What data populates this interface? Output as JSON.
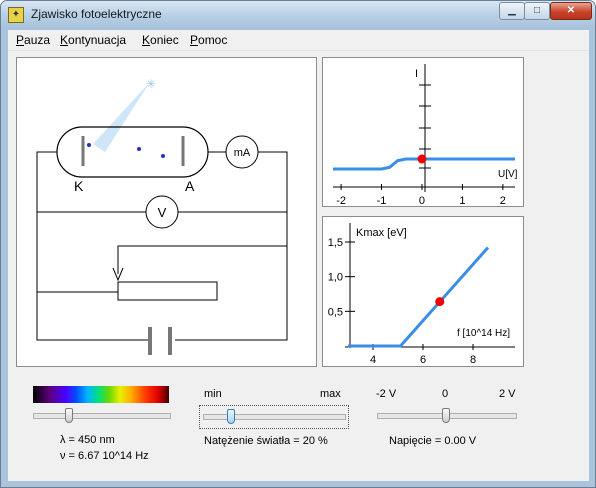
{
  "window": {
    "title": "Zjawisko fotoelektryczne"
  },
  "menu": [
    {
      "label": "Pauza"
    },
    {
      "label": "Kontynuacja"
    },
    {
      "label": "Koniec"
    },
    {
      "label": "Pomoc"
    }
  ],
  "circuit": {
    "cathode_label": "K",
    "anode_label": "A",
    "ammeter_label": "mA",
    "voltmeter_label": "V"
  },
  "iv_graph": {
    "ylabel": "I",
    "xlabel": "U[V]",
    "x_ticks": [
      "-2",
      "-1",
      "0",
      "1",
      "2"
    ]
  },
  "k_graph": {
    "ylabel": "Kmax [eV]",
    "xlabel": "f [10^14 Hz]",
    "x_ticks": [
      "4",
      "6",
      "8"
    ],
    "y_ticks": [
      "1,5",
      "1,0",
      "0,5"
    ]
  },
  "chart_data": [
    {
      "type": "line",
      "title": "",
      "xlabel": "U[V]",
      "ylabel": "I",
      "xlim": [
        -2.2,
        2.3
      ],
      "x": [
        -2.2,
        -1.0,
        -0.8,
        -0.6,
        -0.4,
        -0.2,
        0.0,
        0.3,
        0.6,
        1.0,
        2.3
      ],
      "y": [
        0,
        0,
        0.02,
        0.1,
        0.3,
        0.55,
        0.7,
        0.85,
        0.93,
        0.97,
        1.0
      ],
      "marker": {
        "x": 0.0,
        "color": "#ee0000"
      },
      "line_color": "#3a8ee6"
    },
    {
      "type": "line",
      "title": "",
      "xlabel": "f [10^14 Hz]",
      "ylabel": "Kmax [eV]",
      "xlim": [
        2.9,
        9.4
      ],
      "ylim": [
        0,
        1.75
      ],
      "x": [
        3.0,
        5.1,
        8.6
      ],
      "y": [
        0,
        0,
        1.42
      ],
      "y_ticks": [
        0.5,
        1.0,
        1.5
      ],
      "x_ticks": [
        4,
        6,
        8
      ],
      "marker": {
        "x": 6.67,
        "y": 0.64,
        "color": "#ee0000"
      },
      "line_color": "#3a8ee6"
    }
  ],
  "controls": {
    "wavelength_slider": {
      "value_fraction": 0.25
    },
    "wavelength_text": "λ = 450 nm",
    "frequency_text": "ν = 6.67 10^14 Hz",
    "intensity": {
      "min_label": "min",
      "max_label": "max",
      "value_fraction": 0.2,
      "text": "Natężenie światła = 20 %"
    },
    "voltage": {
      "ticks": [
        "-2 V",
        "0",
        "2 V"
      ],
      "value_fraction": 0.5,
      "text": "Napięcie = 0.00 V"
    }
  }
}
